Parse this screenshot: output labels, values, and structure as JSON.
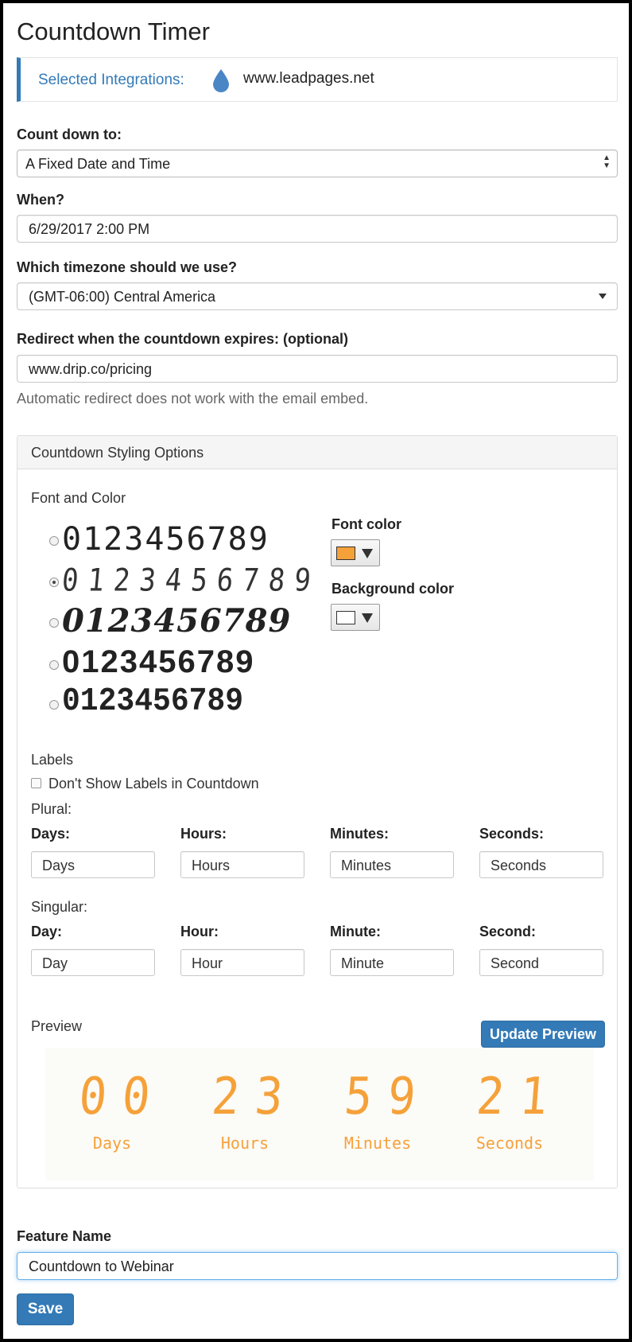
{
  "page": {
    "title": "Countdown Timer"
  },
  "integrations": {
    "label": "Selected Integrations:",
    "site": "www.leadpages.net",
    "icon": "drop-icon",
    "accent": "#337ab7"
  },
  "count_down_to": {
    "label": "Count down to:",
    "value": "A Fixed Date and Time"
  },
  "when": {
    "label": "When?",
    "value": "6/29/2017 2:00 PM"
  },
  "timezone": {
    "label": "Which timezone should we use?",
    "value": "(GMT-06:00) Central America"
  },
  "redirect": {
    "label": "Redirect when the countdown expires: (optional)",
    "value": "www.drip.co/pricing",
    "help": "Automatic redirect does not work with the email embed."
  },
  "styling": {
    "heading": "Countdown Styling Options",
    "font_and_color": "Font and Color",
    "font_samples": [
      "0123456789",
      "0123456789",
      "0123456789",
      "0123456789",
      "0123456789"
    ],
    "selected_font_index": 1,
    "font_color_label": "Font color",
    "font_color": "#f5a13a",
    "background_color_label": "Background color",
    "background_color": "#ffffff"
  },
  "labels": {
    "heading": "Labels",
    "hide_labels": "Don't Show Labels in Countdown",
    "hide_labels_checked": false,
    "plural_heading": "Plural:",
    "plural": {
      "days_label": "Days:",
      "days": "Days",
      "hours_label": "Hours:",
      "hours": "Hours",
      "minutes_label": "Minutes:",
      "minutes": "Minutes",
      "seconds_label": "Seconds:",
      "seconds": "Seconds"
    },
    "singular_heading": "Singular:",
    "singular": {
      "day_label": "Day:",
      "day": "Day",
      "hour_label": "Hour:",
      "hour": "Hour",
      "minute_label": "Minute:",
      "minute": "Minute",
      "second_label": "Second:",
      "second": "Second"
    }
  },
  "preview": {
    "heading": "Preview",
    "update_button": "Update Preview",
    "days": "00",
    "hours": "23",
    "minutes": "59",
    "seconds": "21",
    "days_label": "Days",
    "hours_label": "Hours",
    "minutes_label": "Minutes",
    "seconds_label": "Seconds"
  },
  "feature": {
    "label": "Feature Name",
    "value": "Countdown to Webinar"
  },
  "save_button": "Save"
}
